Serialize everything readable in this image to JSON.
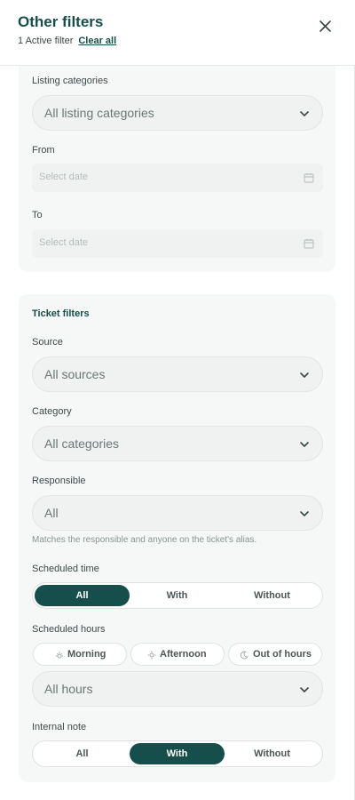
{
  "header": {
    "title": "Other filters",
    "active_filters": "1 Active filter",
    "clear_all": "Clear all"
  },
  "listing": {
    "categories_label": "Listing categories",
    "categories_value": "All listing categories",
    "from_label": "From",
    "from_placeholder": "Select date",
    "to_label": "To",
    "to_placeholder": "Select date"
  },
  "ticket": {
    "section_title": "Ticket filters",
    "source_label": "Source",
    "source_value": "All sources",
    "category_label": "Category",
    "category_value": "All categories",
    "responsible_label": "Responsible",
    "responsible_value": "All",
    "responsible_hint": "Matches the responsible and anyone on the ticket's alias.",
    "scheduled_time_label": "Scheduled time",
    "scheduled_time_options": [
      "All",
      "With",
      "Without"
    ],
    "scheduled_time_selected": "All",
    "scheduled_hours_label": "Scheduled hours",
    "scheduled_hours_pills": [
      "Morning",
      "Afternoon",
      "Out of hours"
    ],
    "hours_value": "All hours",
    "internal_note_label": "Internal note",
    "internal_note_options": [
      "All",
      "With",
      "Without"
    ],
    "internal_note_selected": "With"
  },
  "colors": {
    "brand": "#164e4b",
    "card_bg": "#f6f7f7",
    "input_bg": "#eff2f1"
  },
  "icons": {
    "close": "close-icon",
    "chevron": "chevron-down-icon",
    "calendar": "calendar-icon",
    "morning": "sunrise-icon",
    "afternoon": "sun-icon",
    "night": "moon-icon"
  }
}
